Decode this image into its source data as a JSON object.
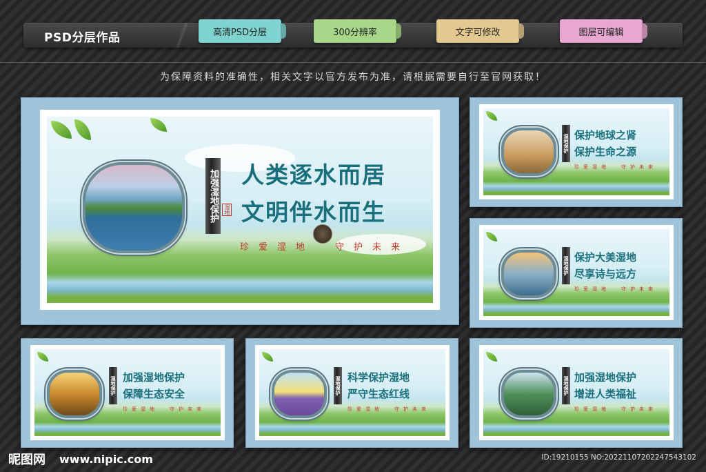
{
  "header": {
    "title": "PSD分层作品",
    "tags": [
      {
        "label": "高清PSD分层",
        "color": "#7fd4cf"
      },
      {
        "label": "300分辨率",
        "color": "#a8d78a"
      },
      {
        "label": "文字可修改",
        "color": "#e3c98f"
      },
      {
        "label": "图层可编辑",
        "color": "#e7a7cf"
      }
    ]
  },
  "notice": "为保障资料的准确性，相关文字以官方发布为准，请根据需要自行至官网获取！",
  "main_board": {
    "vertical_title": "加强湿地保护",
    "seal": "湿地",
    "line1": "人类逐水而居",
    "line2": "文明伴水而生",
    "slogan_left": "珍爱湿地",
    "slogan_right": "守护未来"
  },
  "boards": [
    {
      "vertical_title": "湿地保护",
      "line1": "保护地球之肾",
      "line2": "保护生命之源",
      "slogan_left": "珍爱湿地",
      "slogan_right": "守护未来"
    },
    {
      "vertical_title": "湿地保护",
      "line1": "保护大美湿地",
      "line2": "尽享诗与远方",
      "slogan_left": "珍爱湿地",
      "slogan_right": "守护未来"
    },
    {
      "vertical_title": "湿地保护",
      "line1": "加强湿地保护",
      "line2": "保障生态安全",
      "slogan_left": "珍爱湿地",
      "slogan_right": "守护未来"
    },
    {
      "vertical_title": "湿地保护",
      "line1": "科学保护湿地",
      "line2": "严守生态红线",
      "slogan_left": "珍爱湿地",
      "slogan_right": "守护未来"
    },
    {
      "vertical_title": "湿地保护",
      "line1": "加强湿地保护",
      "line2": "增进人类福祉",
      "slogan_left": "珍爱湿地",
      "slogan_right": "守护未来"
    }
  ],
  "footer": {
    "logo": "昵图网",
    "url": "www.nipic.com",
    "id_text": "ID:19210155 NO:20221107202247543102"
  }
}
